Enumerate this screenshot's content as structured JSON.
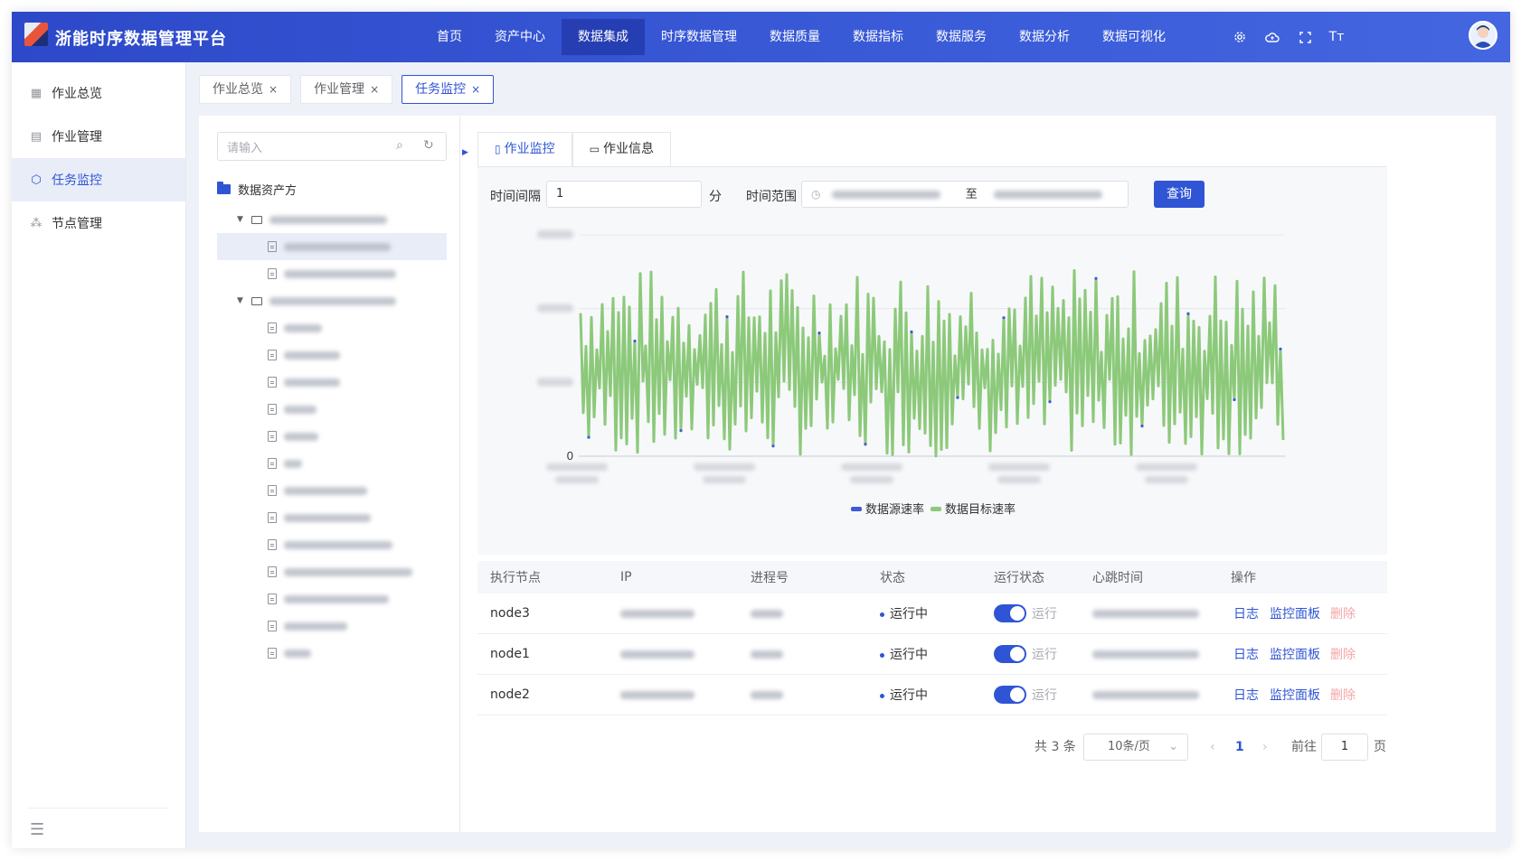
{
  "header": {
    "brand": "浙能时序数据管理平台",
    "nav": [
      "首页",
      "资产中心",
      "数据集成",
      "时序数据管理",
      "数据质量",
      "数据指标",
      "数据服务",
      "数据分析",
      "数据可视化"
    ],
    "active_nav": "数据集成",
    "icons": [
      "settings-icon",
      "cloud-icon",
      "fullscreen-icon",
      "font-size-icon"
    ],
    "font_size_label": "Tт"
  },
  "sidebar": {
    "items": [
      {
        "label": "作业总览",
        "icon": "grid-icon"
      },
      {
        "label": "作业管理",
        "icon": "doc-edit-icon"
      },
      {
        "label": "任务监控",
        "icon": "hexagon-icon"
      },
      {
        "label": "节点管理",
        "icon": "nodes-icon"
      }
    ],
    "active": "任务监控"
  },
  "page_tabs": [
    {
      "label": "作业总览",
      "close": "×"
    },
    {
      "label": "作业管理",
      "close": "×"
    },
    {
      "label": "任务监控",
      "close": "×"
    }
  ],
  "tree": {
    "search_placeholder": "请输入",
    "root_label": "数据资产方"
  },
  "panel_tabs": [
    "作业监控",
    "作业信息"
  ],
  "filters": {
    "interval_label": "时间间隔",
    "interval_value": "1",
    "interval_unit": "分",
    "range_label": "时间范围",
    "range_separator": "至",
    "query_label": "查询"
  },
  "chart_data": {
    "type": "line",
    "ylabel_ticks": [
      "0"
    ],
    "legend": [
      "数据源速率",
      "数据目标速率"
    ],
    "colors": {
      "source": "#3f5ad8",
      "target": "#8cc97a"
    },
    "series_note": "dense oscillating series, values mostly between 0 and ~2.6 of 3 gridline units",
    "grid": true,
    "legend_position": "bottom-center"
  },
  "table": {
    "columns": [
      "执行节点",
      "IP",
      "进程号",
      "状态",
      "运行状态",
      "心跳时间",
      "操作"
    ],
    "rows": [
      {
        "node": "node3",
        "status": "运行中",
        "run_state": "运行",
        "actions": [
          "日志",
          "监控面板",
          "删除"
        ]
      },
      {
        "node": "node1",
        "status": "运行中",
        "run_state": "运行",
        "actions": [
          "日志",
          "监控面板",
          "删除"
        ]
      },
      {
        "node": "node2",
        "status": "运行中",
        "run_state": "运行",
        "actions": [
          "日志",
          "监控面板",
          "删除"
        ]
      }
    ]
  },
  "pagination": {
    "total": "共 3 条",
    "page_size": "10条/页",
    "current_page": "1",
    "goto_label": "前往",
    "goto_value": "1",
    "page_unit": "页"
  },
  "colors": {
    "primary": "#2f55d4",
    "header": "#3a5bd8"
  }
}
